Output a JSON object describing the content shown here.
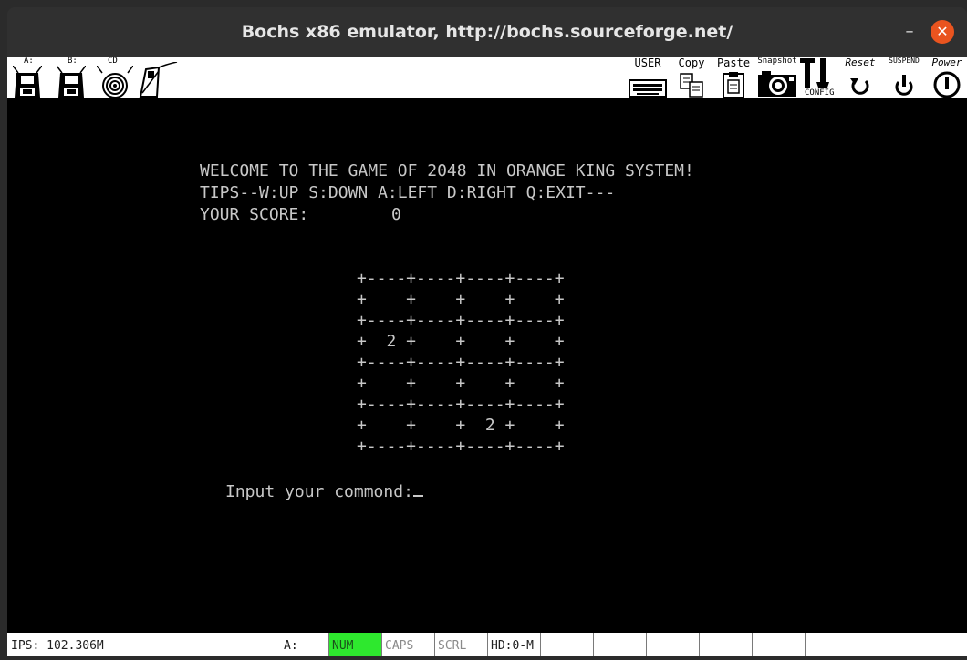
{
  "window": {
    "title": "Bochs x86 emulator, http://bochs.sourceforge.net/",
    "minimize_glyph": "–",
    "close_glyph": "✕",
    "close_color": "#e9541f"
  },
  "toolbar": {
    "left": [
      {
        "id": "floppy-a",
        "label": "A:",
        "icon": "floppy-icon"
      },
      {
        "id": "floppy-b",
        "label": "B:",
        "icon": "floppy-icon"
      },
      {
        "id": "cdrom",
        "label": "CD",
        "icon": "cdrom-icon"
      },
      {
        "id": "mouse",
        "label": "",
        "icon": "mouse-icon"
      }
    ],
    "right": [
      {
        "id": "user",
        "label": "USER",
        "icon": "keyboard-icon"
      },
      {
        "id": "copy",
        "label": "Copy",
        "icon": "copy-icon"
      },
      {
        "id": "paste",
        "label": "Paste",
        "icon": "paste-icon"
      },
      {
        "id": "snapshot",
        "label": "Snapshot",
        "icon": "camera-icon"
      },
      {
        "id": "config",
        "label": "CONFIG",
        "icon": "config-icon"
      },
      {
        "id": "reset",
        "label": "Reset",
        "icon": "reset-icon"
      },
      {
        "id": "suspend",
        "label": "SUSPEND",
        "icon": "suspend-icon"
      },
      {
        "id": "power",
        "label": "Power",
        "icon": "power-icon"
      }
    ]
  },
  "screen": {
    "welcome": "WELCOME TO THE GAME OF 2048 IN ORANGE KING SYSTEM!",
    "tips": "TIPS--W:UP S:DOWN A:LEFT D:RIGHT Q:EXIT---",
    "score_label": "YOUR SCORE:",
    "score_value": "0",
    "board_border": "+----+----+----+----+",
    "board_rows": [
      "+    +    +    +    +",
      "+  2 +    +    +    +",
      "+    +    +    +    +",
      "+    +    +  2 +    +"
    ],
    "prompt": "Input your commond:",
    "fg_color": "#c8c8c8"
  },
  "status": {
    "ips": "IPS: 102.306M",
    "floppy": "A:",
    "num": "NUM",
    "caps": "CAPS",
    "scrl": "SCRL",
    "hd": "HD:0-M",
    "num_color": "#2ee82e"
  }
}
